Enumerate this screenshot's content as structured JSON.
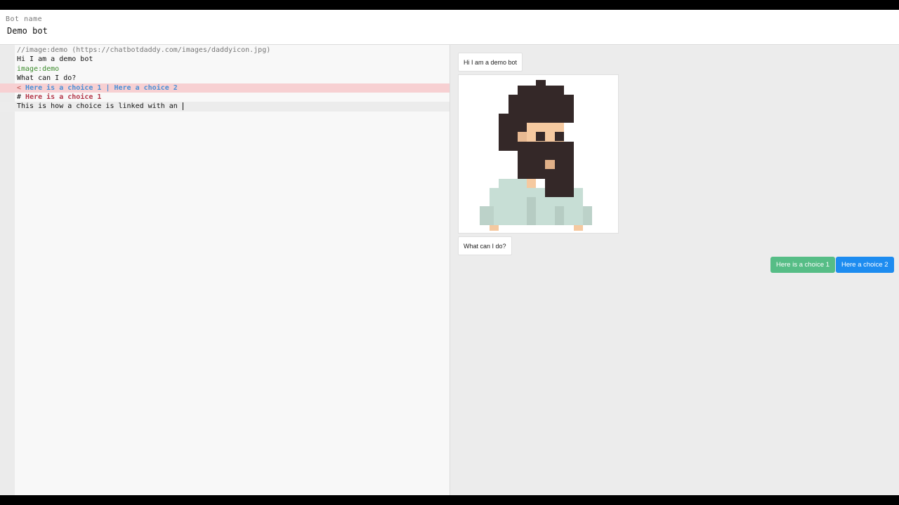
{
  "header": {
    "label": "Bot name",
    "bot_name": "Demo bot"
  },
  "editor": {
    "lines": [
      {
        "text": "//image:demo (https://chatbotdaddy.com/images/daddyicon.jpg)"
      },
      {
        "text": "Hi I am a demo bot"
      },
      {
        "text": "image:demo"
      },
      {
        "text": "What can I do?"
      },
      {
        "prefix": "< ",
        "choice1": "Here is a choice 1",
        "sep": " | ",
        "choice2": "Here a choice 2"
      },
      {
        "prefix": "# ",
        "anchor": "Here is a choice 1"
      },
      {
        "text": "This is how a choice is linked with an "
      }
    ]
  },
  "chat": {
    "messages": [
      "Hi I am a demo bot",
      "What can I do?"
    ],
    "image_alt": "demo",
    "choices": [
      "Here is a choice 1",
      "Here a choice 2"
    ]
  },
  "colors": {
    "choice1": "#56bd86",
    "choice2": "#1d8cf0",
    "highlight_line": "#f7d0d2"
  }
}
